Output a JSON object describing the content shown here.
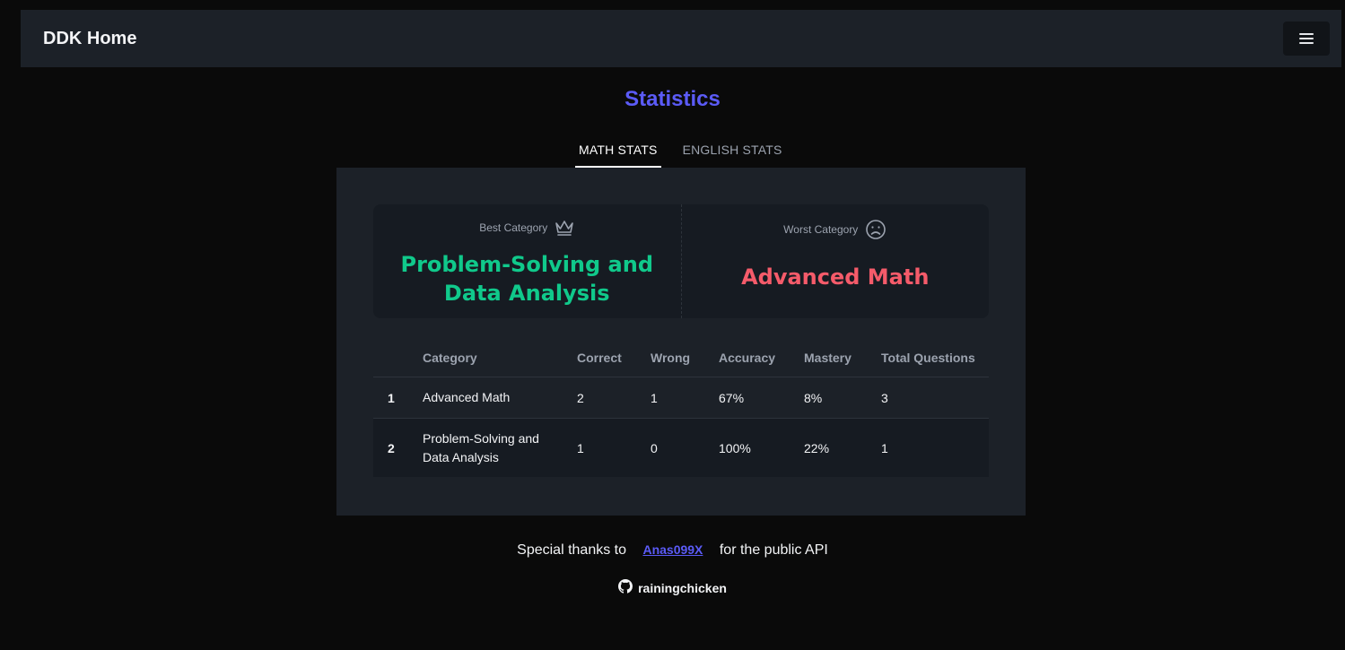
{
  "navbar": {
    "brand": "DDK Home",
    "menu_icon": "hamburger-menu-icon"
  },
  "page": {
    "title": "Statistics"
  },
  "tabs": [
    {
      "label": "MATH STATS",
      "active": true
    },
    {
      "label": "ENGLISH STATS",
      "active": false
    }
  ],
  "summary": {
    "best": {
      "label": "Best Category",
      "icon": "crown-icon",
      "value": "Problem-Solving and Data Analysis",
      "color": "#10c98b"
    },
    "worst": {
      "label": "Worst Category",
      "icon": "sad-face-icon",
      "value": "Advanced Math",
      "color": "#f55b6a"
    }
  },
  "table": {
    "headers": [
      "",
      "Category",
      "Correct",
      "Wrong",
      "Accuracy",
      "Mastery",
      "Total Questions"
    ],
    "rows": [
      {
        "rank": "1",
        "category": "Advanced Math",
        "correct": "2",
        "wrong": "1",
        "accuracy": "67%",
        "mastery": "8%",
        "total": "3"
      },
      {
        "rank": "2",
        "category": "Problem-Solving and Data Analysis",
        "correct": "1",
        "wrong": "0",
        "accuracy": "100%",
        "mastery": "22%",
        "total": "1"
      }
    ]
  },
  "footer": {
    "thanks_prefix": "Special thanks to",
    "thanks_link": "Anas099X",
    "thanks_suffix": "for the public API",
    "github_icon": "github-icon",
    "github_user": "rainingchicken"
  },
  "colors": {
    "accent": "#5b5bf7",
    "background": "#0a0a0a",
    "surface": "#1c2128"
  }
}
